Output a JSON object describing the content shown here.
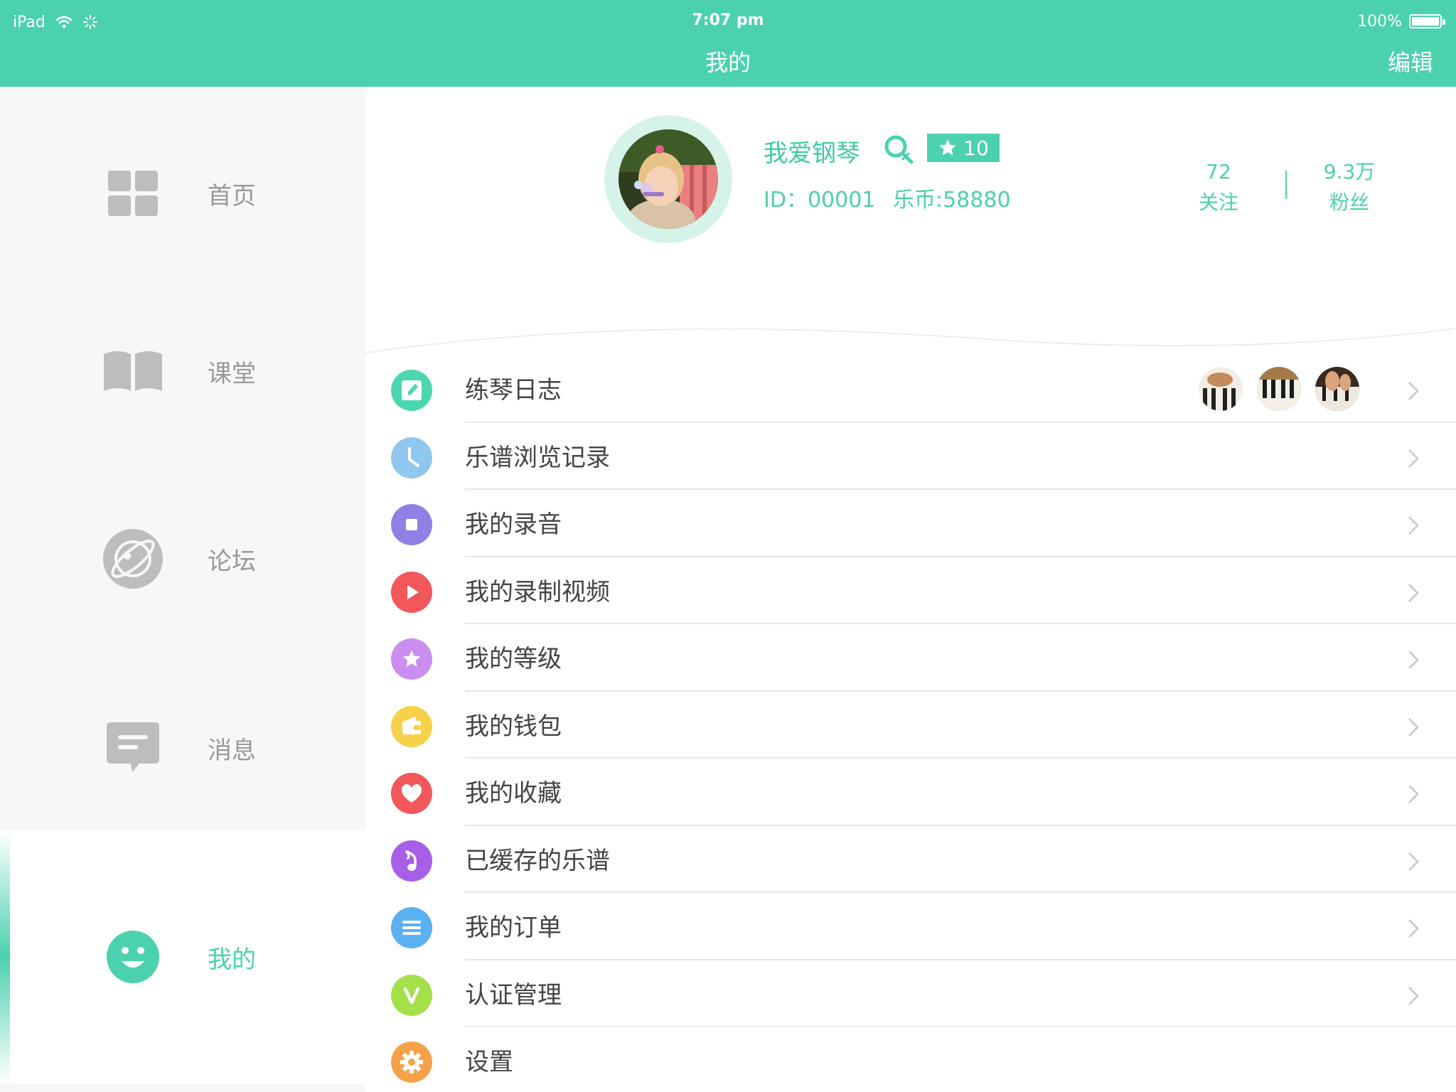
{
  "status_bar": {
    "device": "iPad",
    "time": "7:07 pm",
    "battery": "100%"
  },
  "nav": {
    "title": "我的",
    "edit_label": "编辑"
  },
  "sidebar": {
    "items": [
      {
        "label": "首页",
        "icon": "grid-icon"
      },
      {
        "label": "课堂",
        "icon": "book-icon"
      },
      {
        "label": "论坛",
        "icon": "planet-icon"
      },
      {
        "label": "消息",
        "icon": "message-icon"
      },
      {
        "label": "我的",
        "icon": "smiley-icon",
        "active": true
      }
    ]
  },
  "profile": {
    "username": "我爱钢琴",
    "level": "10",
    "id_text": "ID：00001",
    "coins_text": "乐币:58880",
    "following_count": "72",
    "following_label": "关注",
    "fans_count": "9.3万",
    "fans_label": "粉丝"
  },
  "menu": {
    "items": [
      {
        "label": "练琴日志",
        "icon": "journal-icon",
        "color": "#4bd6b0"
      },
      {
        "label": "乐谱浏览记录",
        "icon": "clock-icon",
        "color": "#8fc7ee"
      },
      {
        "label": "我的录音",
        "icon": "record-icon",
        "color": "#8f80e6"
      },
      {
        "label": "我的录制视频",
        "icon": "play-icon",
        "color": "#f2575c"
      },
      {
        "label": "我的等级",
        "icon": "star-icon",
        "color": "#c98ef0"
      },
      {
        "label": "我的钱包",
        "icon": "wallet-icon",
        "color": "#f7d14a"
      },
      {
        "label": "我的收藏",
        "icon": "heart-icon",
        "color": "#f2575c"
      },
      {
        "label": "已缓存的乐谱",
        "icon": "music-note-icon",
        "color": "#a85ee6"
      },
      {
        "label": "我的订单",
        "icon": "list-icon",
        "color": "#5ab0f0"
      },
      {
        "label": "认证管理",
        "icon": "verified-v-icon",
        "color": "#a3e04a"
      },
      {
        "label": "设置",
        "icon": "gear-icon",
        "color": "#f5a14a"
      }
    ]
  },
  "colors": {
    "accent": "#4bd1ad",
    "sidebar_bg": "#f7f7f7",
    "inactive_text": "#999999"
  }
}
